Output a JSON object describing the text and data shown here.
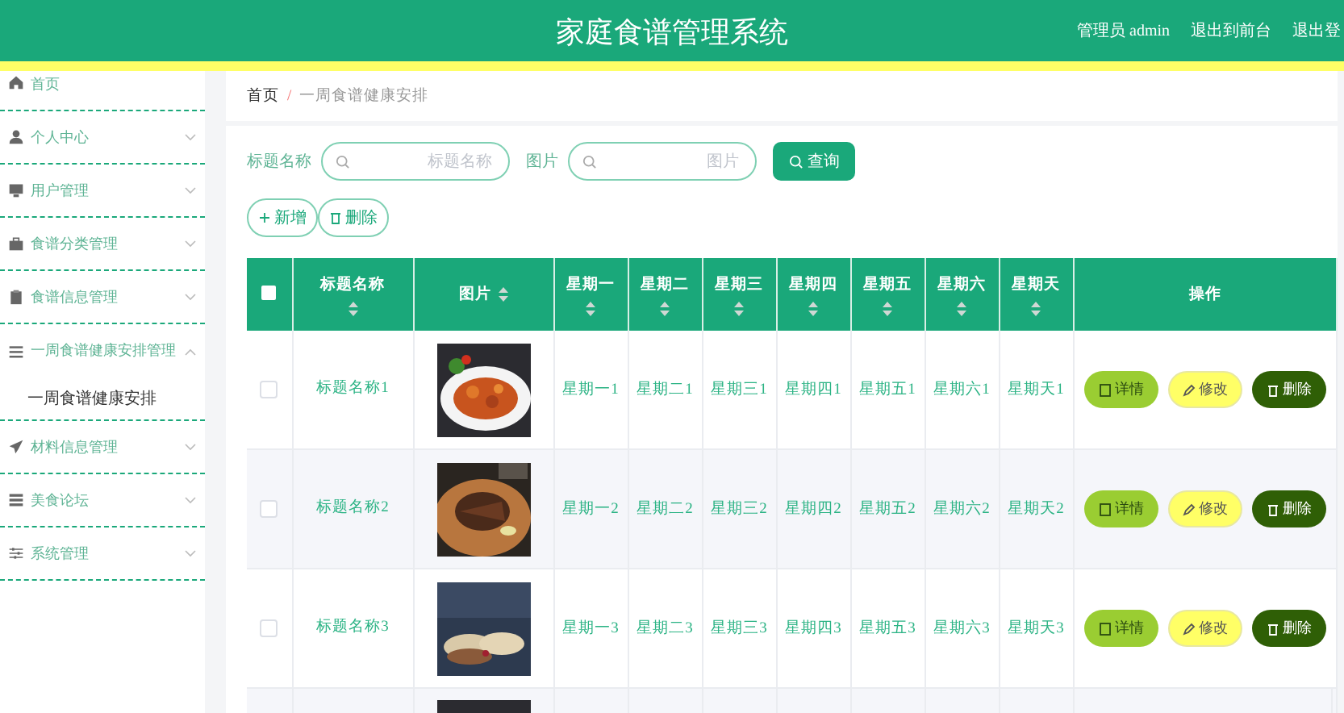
{
  "header": {
    "title": "家庭食谱管理系统",
    "links": [
      "管理员 admin",
      "退出到前台",
      "退出登"
    ]
  },
  "sidebar": {
    "items": [
      {
        "label": "首页",
        "kind": "link"
      },
      {
        "label": "个人中心",
        "kind": "menu",
        "expanded": false
      },
      {
        "label": "用户管理",
        "kind": "menu",
        "expanded": false
      },
      {
        "label": "食谱分类管理",
        "kind": "menu",
        "expanded": false
      },
      {
        "label": "食谱信息管理",
        "kind": "menu",
        "expanded": false
      },
      {
        "label": "一周食谱健康安排管理",
        "kind": "menu",
        "expanded": true,
        "children": [
          {
            "label": "一周食谱健康安排",
            "selected": true
          }
        ]
      },
      {
        "label": "材料信息管理",
        "kind": "menu",
        "expanded": false
      },
      {
        "label": "美食论坛",
        "kind": "menu",
        "expanded": false
      },
      {
        "label": "系统管理",
        "kind": "menu",
        "expanded": false
      }
    ]
  },
  "breadcrumb": [
    "首页",
    "/",
    "一周食谱健康安排"
  ],
  "search": {
    "fields": [
      {
        "label": "标题名称",
        "placeholder": "标题名称"
      },
      {
        "label": "图片",
        "placeholder": "图片"
      }
    ],
    "button": "查询"
  },
  "toolbar": [
    "新增",
    "删除"
  ],
  "table": {
    "select_all": {
      "checked": false
    },
    "columns": [
      {
        "label": "标题名称",
        "sortable": true
      },
      {
        "label": "图片",
        "sortable": true
      },
      {
        "label": "星期一",
        "sortable": true
      },
      {
        "label": "星期二",
        "sortable": true
      },
      {
        "label": "星期三",
        "sortable": true
      },
      {
        "label": "星期四",
        "sortable": true
      },
      {
        "label": "星期五",
        "sortable": true
      },
      {
        "label": "星期六",
        "sortable": true
      },
      {
        "label": "星期天",
        "sortable": true
      },
      {
        "label": "操作",
        "sortable": false
      }
    ],
    "rows": [
      {
        "kind": "full",
        "checked": false,
        "title": "标题名称1",
        "picture": {
          "kind": "picture"
        },
        "days": [
          "星期一1",
          "星期二1",
          "星期三1",
          "星期四1",
          "星期五1",
          "星期六1",
          "星期天1"
        ],
        "actions": [
          "详情",
          "修改",
          "删除"
        ]
      },
      {
        "kind": "full",
        "checked": false,
        "title": "标题名称2",
        "picture": {
          "kind": "picture"
        },
        "days": [
          "星期一2",
          "星期二2",
          "星期三2",
          "星期四2",
          "星期五2",
          "星期六2",
          "星期天2"
        ],
        "actions": [
          "详情",
          "修改",
          "删除"
        ]
      },
      {
        "kind": "full",
        "checked": false,
        "title": "标题名称3",
        "picture": {
          "kind": "picture"
        },
        "days": [
          "星期一3",
          "星期二3",
          "星期三3",
          "星期四3",
          "星期五3",
          "星期六3",
          "星期天3"
        ],
        "actions": [
          "详情",
          "修改",
          "删除"
        ]
      },
      {
        "kind": "partial",
        "picture": {
          "kind": "picture"
        }
      }
    ]
  }
}
